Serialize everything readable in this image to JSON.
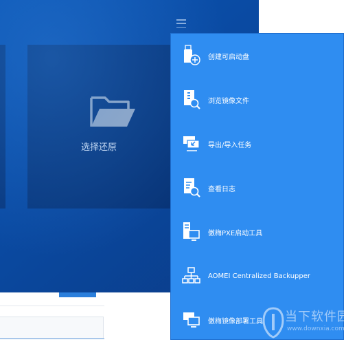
{
  "main": {
    "tile_restore_label": "选择还原"
  },
  "menu": {
    "items": [
      {
        "label": "创建可启动盘",
        "icon": "usb-drive-add-icon"
      },
      {
        "label": "浏览镜像文件",
        "icon": "browse-image-file-icon"
      },
      {
        "label": "导出/导入任务",
        "icon": "export-import-task-icon"
      },
      {
        "label": "查看日志",
        "icon": "view-log-icon"
      },
      {
        "label": "傲梅PXE启动工具",
        "icon": "pxe-boot-tool-icon"
      },
      {
        "label": "AOMEI Centralized Backupper",
        "icon": "network-topology-icon"
      },
      {
        "label": "傲梅镜像部署工具",
        "icon": "image-deploy-tool-icon"
      }
    ]
  },
  "watermark": {
    "text": "当下软件园",
    "url": "www.downxia.com"
  },
  "colors": {
    "background_blue": "#0a4aa2",
    "menu_blue": "#2f8df1"
  }
}
